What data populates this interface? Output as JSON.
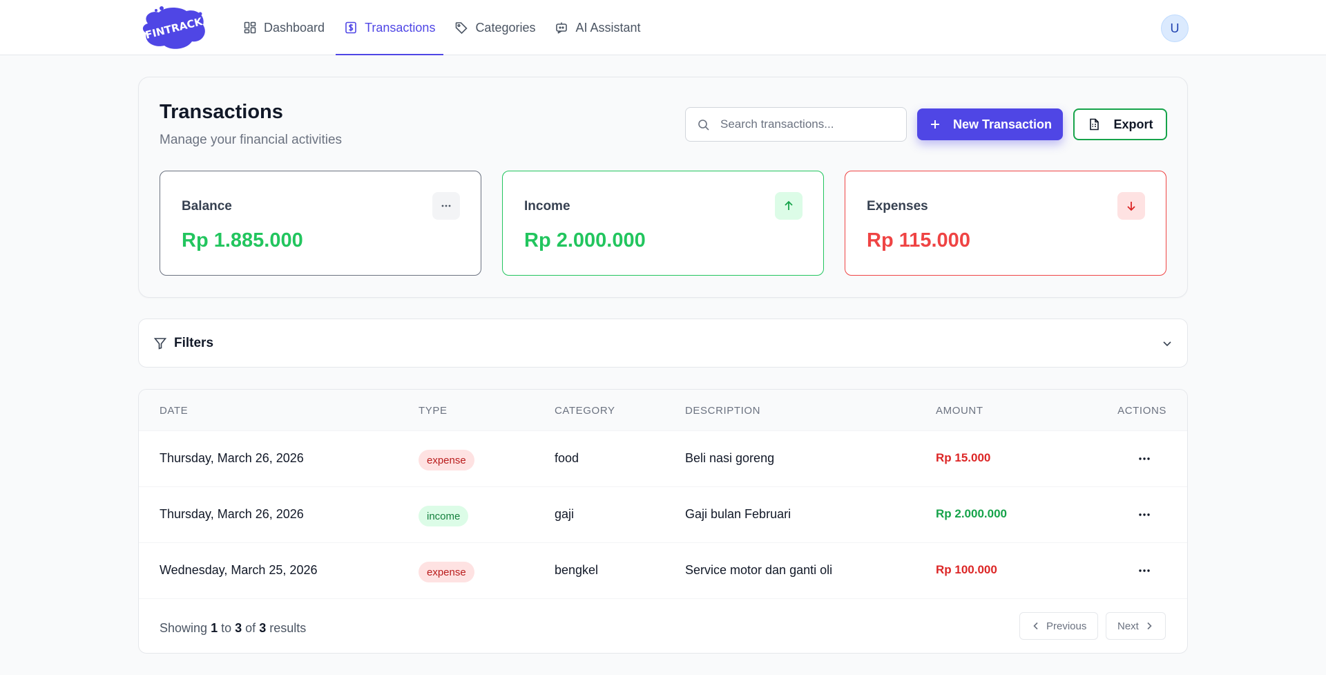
{
  "nav": {
    "logo_text": "FINTRACK",
    "items": [
      {
        "label": "Dashboard",
        "icon": "dashboard-icon",
        "active": false
      },
      {
        "label": "Transactions",
        "icon": "dollar-square-icon",
        "active": true
      },
      {
        "label": "Categories",
        "icon": "tag-icon",
        "active": false
      },
      {
        "label": "AI Assistant",
        "icon": "chatbot-icon",
        "active": false
      }
    ],
    "avatar_initial": "U"
  },
  "header": {
    "title": "Transactions",
    "subtitle": "Manage your financial activities",
    "search_placeholder": "Search transactions...",
    "new_button": "New Transaction",
    "export_button": "Export"
  },
  "stats": {
    "balance": {
      "label": "Balance",
      "value": "Rp 1.885.000"
    },
    "income": {
      "label": "Income",
      "value": "Rp 2.000.000"
    },
    "expenses": {
      "label": "Expenses",
      "value": "Rp 115.000"
    }
  },
  "filters": {
    "label": "Filters"
  },
  "table": {
    "headers": {
      "date": "Date",
      "type": "Type",
      "category": "Category",
      "description": "Description",
      "amount": "Amount",
      "actions": "Actions"
    },
    "rows": [
      {
        "date": "Thursday, March 26, 2026",
        "type": "expense",
        "category": "food",
        "description": "Beli nasi goreng",
        "amount": "Rp 15.000"
      },
      {
        "date": "Thursday, March 26, 2026",
        "type": "income",
        "category": "gaji",
        "description": "Gaji bulan Februari",
        "amount": "Rp 2.000.000"
      },
      {
        "date": "Wednesday, March 25, 2026",
        "type": "expense",
        "category": "bengkel",
        "description": "Service motor dan ganti oli",
        "amount": "Rp 100.000"
      }
    ]
  },
  "pagination": {
    "showing": "Showing",
    "from": "1",
    "to_word": "to",
    "to": "3",
    "of_word": "of",
    "total": "3",
    "results": "results",
    "previous": "Previous",
    "next": "Next"
  },
  "colors": {
    "accent": "#4f46e5",
    "income": "#22c55e",
    "expense": "#ef4444"
  }
}
